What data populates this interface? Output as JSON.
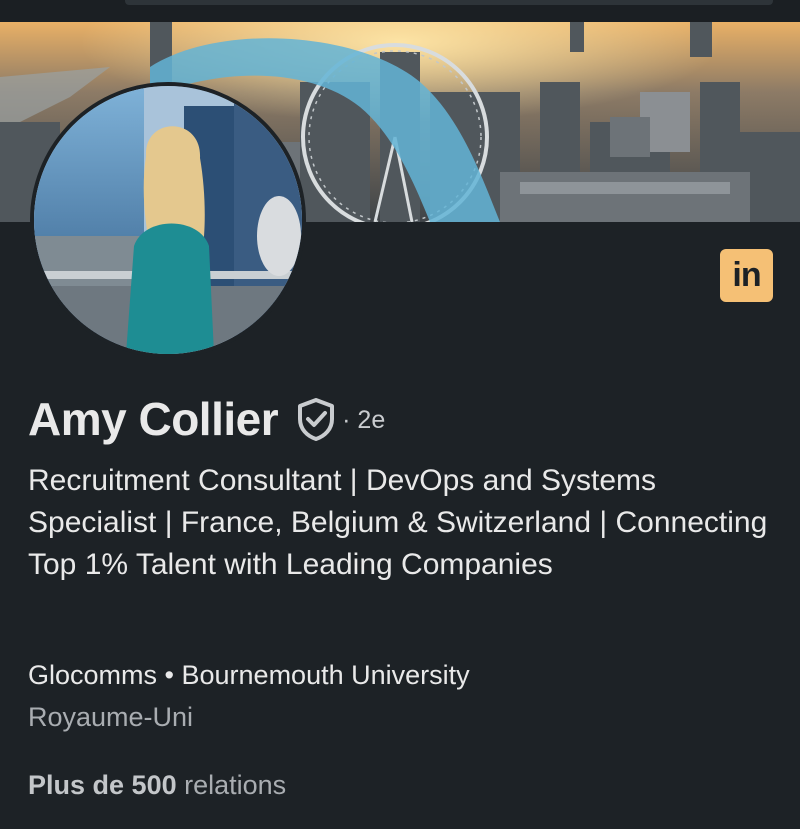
{
  "profile": {
    "name": "Amy Collier",
    "verified_icon": "verified-shield-icon",
    "degree": "· 2e",
    "headline": "Recruitment Consultant | DevOps and Systems Specialist | France, Belgium & Switzerland | Connecting Top 1% Talent with Leading Companies",
    "company": "Glocomms",
    "separator": "•",
    "school": "Bournemouth University",
    "location": "Royaume-Uni",
    "connections_prefix": "Plus de",
    "connections_count": "500",
    "connections_suffix": "relations",
    "brand_badge_text": "in"
  },
  "colors": {
    "background": "#1d2226",
    "brand_badge": "#f5c075",
    "banner_arc": "#63b4d6"
  }
}
